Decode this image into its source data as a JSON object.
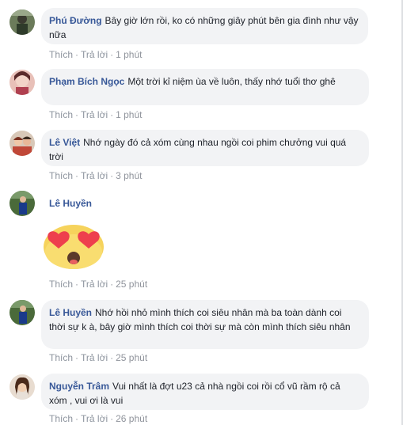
{
  "comments": [
    {
      "author": "Phú Đường",
      "text": "Bây giờ lớn rồi, ko có những giây phút bên gia đình như vậy nữa",
      "like": "Thích",
      "reply": "Trả lời",
      "time": "1 phút"
    },
    {
      "author": "Phạm Bích Ngọc",
      "text": "Một trời kỉ niệm ùa về luôn, thấy nhớ tuổi thơ ghê",
      "like": "Thích",
      "reply": "Trả lời",
      "time": "1 phút"
    },
    {
      "author": "Lê Việt",
      "text": "Nhớ ngày đó cả xóm cùng nhau ngồi coi phim chưởng vui quá trời",
      "like": "Thích",
      "reply": "Trả lời",
      "time": "3 phút"
    },
    {
      "author": "Lê Huyền",
      "sticker": "heart-eyes-emoji",
      "like": "Thích",
      "reply": "Trả lời",
      "time": "25 phút"
    },
    {
      "author": "Lê Huyền",
      "text": "Nhớ hồi nhỏ mình thích coi siêu nhân mà ba toàn dành coi thời sự k à, bây giờ mình thích coi thời sự mà còn mình thích siêu nhân",
      "like": "Thích",
      "reply": "Trả lời",
      "time": "25 phút"
    },
    {
      "author": "Nguyễn Trâm",
      "text": "Vui nhất là đợt u23 cả nhà ngồi coi rồi cổ vũ rầm rộ cả xóm , vui ơi là vui",
      "like": "Thích",
      "reply": "Trả lời",
      "time": "26 phút"
    }
  ],
  "colors": {
    "link": "#385898",
    "bubble": "#f2f3f5",
    "meta": "#90949c"
  },
  "dot": "·"
}
